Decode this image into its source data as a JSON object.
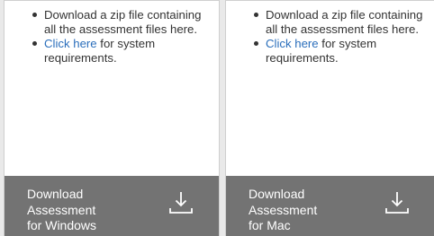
{
  "cards": [
    {
      "bullet1": "Download a zip file containing all the assessment files here.",
      "link": "Click here",
      "bullet2_rest": " for system requirements.",
      "download_lines": [
        "Download",
        "Assessment",
        "for Windows"
      ],
      "icon": "download-icon"
    },
    {
      "bullet1": "Download a zip file containing all the assessment files here.",
      "link": "Click here",
      "bullet2_rest": " for system requirements.",
      "download_lines": [
        "Download",
        "Assessment",
        "for Mac"
      ],
      "icon": "download-icon"
    }
  ],
  "colors": {
    "link": "#2a6ebb",
    "download_bar": "#737373",
    "text": "#333333"
  }
}
